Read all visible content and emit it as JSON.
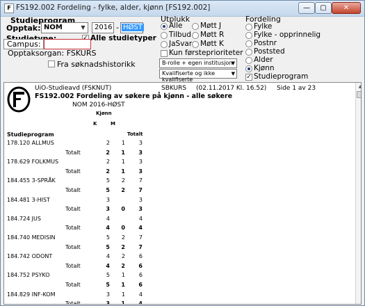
{
  "window": {
    "title": "FS192.002 Fordeling - fylke, alder, kjønn [FS192.002]",
    "app_icon": "F",
    "minimize": "—",
    "maximize": "▢",
    "close": "✕"
  },
  "studieprogram": {
    "heading": "Studieprogram",
    "opptak_label": "Opptak:",
    "opptak_value": "NOM",
    "year": "2016",
    "dash": "-",
    "term": "HØST",
    "studietype_label": "Studietype:",
    "alle_studietyper": "Alle studietyper",
    "campus_label": "Campus:",
    "campus_value": "",
    "opptaksorgan_label": "Opptaksorgan: FSKURS",
    "fra_soknadshistorikk": "Fra søknadshistorikk"
  },
  "utplukk": {
    "heading": "Utplukk",
    "options": [
      "Alle",
      "Tilbud",
      "JaSvar",
      "Møtt J",
      "Møtt R",
      "Møtt K"
    ],
    "selected": "Alle",
    "kun_forsteprioriteter": "Kun førsteprioriteter",
    "dropdown1": "B-rolle + egen institusjon",
    "dropdown2": "Kvalifiserte og ikke kvalifiserte"
  },
  "fordeling": {
    "heading": "Fordeling",
    "options": [
      "Fylke",
      "Fylke - opprinnelig",
      "Postnr",
      "Poststed",
      "Alder",
      "Kjønn"
    ],
    "selected": "Kjønn",
    "studieprogram_checkbox": "Studieprogram"
  },
  "report": {
    "institution": "UiO-Studieavd (FSKNUT)",
    "user": "SBKURS",
    "timestamp": "(02.11.2017 Kl. 16.52)",
    "page": "Side 1 av 23",
    "title": "FS192.002 Fordeling av søkere på kjønn - alle søkere",
    "subtitle": "NOM 2016-HØST",
    "kjonn_header": "Kjønn",
    "col_k": "K",
    "col_m": "M",
    "col_totalt": "Totalt",
    "row_header": "Studieprogram",
    "totalt_label": "Totalt",
    "rows": [
      {
        "program": "178.120 ALLMUS",
        "k": "2",
        "m": "1",
        "total": "3",
        "tk": "2",
        "tm": "1",
        "tt": "3"
      },
      {
        "program": "178.629 FOLKMUS",
        "k": "2",
        "m": "1",
        "total": "3",
        "tk": "2",
        "tm": "1",
        "tt": "3"
      },
      {
        "program": "184.455 3-SPRÅK",
        "k": "5",
        "m": "2",
        "total": "7",
        "tk": "5",
        "tm": "2",
        "tt": "7"
      },
      {
        "program": "184.481 3-HIST",
        "k": "3",
        "m": "",
        "total": "3",
        "tk": "3",
        "tm": "0",
        "tt": "3"
      },
      {
        "program": "184.724 JUS",
        "k": "4",
        "m": "",
        "total": "4",
        "tk": "4",
        "tm": "0",
        "tt": "4"
      },
      {
        "program": "184.740 MEDISIN",
        "k": "5",
        "m": "2",
        "total": "7",
        "tk": "5",
        "tm": "2",
        "tt": "7"
      },
      {
        "program": "184.742 ODONT",
        "k": "4",
        "m": "2",
        "total": "6",
        "tk": "4",
        "tm": "2",
        "tt": "6"
      },
      {
        "program": "184.752 PSYKO",
        "k": "5",
        "m": "1",
        "total": "6",
        "tk": "5",
        "tm": "1",
        "tt": "6"
      },
      {
        "program": "184.829 INF-KOM",
        "k": "3",
        "m": "1",
        "total": "4",
        "tk": "3",
        "tm": "1",
        "tt": "4"
      }
    ]
  }
}
